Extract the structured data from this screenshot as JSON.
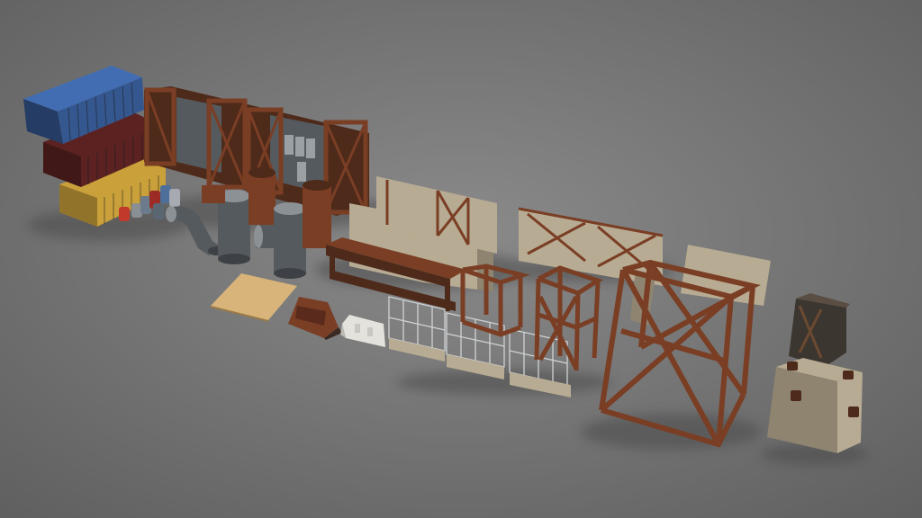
{
  "scene": {
    "background": {
      "inner": "#8a8a8a",
      "outer": "#5f5f5f"
    },
    "shadow_color": "#4c4c4c",
    "palette": {
      "container_blue": "#35578f",
      "container_red": "#5c2222",
      "container_yellow": "#c9a03a",
      "rust": "#7a3e24",
      "rust_dark": "#4e2a1a",
      "steel": "#555a5e",
      "steel_light": "#8c9196",
      "concrete": "#b7ab93",
      "concrete_dark": "#8e8470",
      "plywood": "#d8b47a",
      "barrier_white": "#e4e2dc",
      "fence_wire": "#cfd2d4"
    },
    "assets": [
      {
        "name": "shipping-container-blue"
      },
      {
        "name": "shipping-container-red"
      },
      {
        "name": "shipping-container-yellow"
      },
      {
        "name": "oil-barrels-cluster"
      },
      {
        "name": "rusty-girder-frame-wall"
      },
      {
        "name": "pipe-elbow"
      },
      {
        "name": "pipe-straight"
      },
      {
        "name": "pipe-tee"
      },
      {
        "name": "concrete-panel-wall"
      },
      {
        "name": "rusty-bench-table"
      },
      {
        "name": "plywood-sheet"
      },
      {
        "name": "wooden-crate-barrier"
      },
      {
        "name": "plastic-jersey-barrier"
      },
      {
        "name": "wire-fence-panels"
      },
      {
        "name": "steel-cube-frame-small"
      },
      {
        "name": "steel-cube-frame-large"
      },
      {
        "name": "concrete-block"
      },
      {
        "name": "metal-bin"
      }
    ]
  }
}
